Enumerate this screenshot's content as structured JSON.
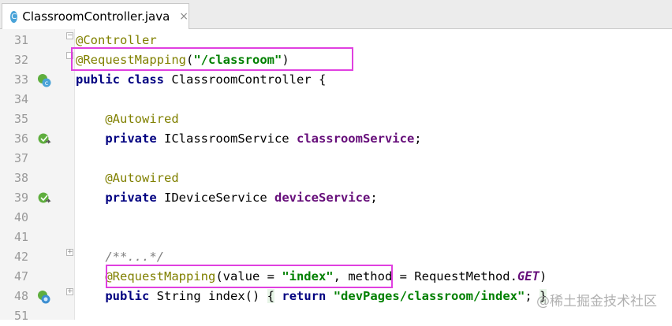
{
  "tab": {
    "icon": "class-icon",
    "icon_letter": "C",
    "filename": "ClassroomController.java",
    "close": "×"
  },
  "lines": [
    {
      "num": "31",
      "text": "@Controller"
    },
    {
      "num": "32",
      "text": "@RequestMapping(\"/classroom\")"
    },
    {
      "num": "33",
      "text": "public class ClassroomController {"
    },
    {
      "num": "34",
      "text": ""
    },
    {
      "num": "35",
      "text": "@Autowired"
    },
    {
      "num": "36",
      "text": "private IClassroomService classroomService;"
    },
    {
      "num": "37",
      "text": ""
    },
    {
      "num": "38",
      "text": "@Autowired"
    },
    {
      "num": "39",
      "text": "private IDeviceService deviceService;"
    },
    {
      "num": "40",
      "text": ""
    },
    {
      "num": "41",
      "text": ""
    },
    {
      "num": "42",
      "text": "/**...*/"
    },
    {
      "num": "47",
      "text": "@RequestMapping(value = \"index\", method = RequestMethod.GET)"
    },
    {
      "num": "48",
      "text": "public String index() { return \"devPages/classroom/index\"; }"
    },
    {
      "num": "51",
      "text": ""
    }
  ],
  "tokens": {
    "controller": "@Controller",
    "request_mapping": "@RequestMapping",
    "classroom_path": "\"/classroom\"",
    "public": "public",
    "class": "class",
    "class_name": "ClassroomController {",
    "autowired": "@Autowired",
    "private": "private",
    "iclassroom_type": "IClassroomService",
    "classroom_field": "classroomService",
    "idevice_type": "IDeviceService",
    "device_field": "deviceService",
    "javadoc": "/**...*/",
    "value_eq": "value = ",
    "index_str": "\"index\"",
    "method_eq": " method = RequestMethod.",
    "get_const": "GET",
    "string_type": "String",
    "index_method": "index() ",
    "return": "return",
    "dev_path": "\"devPages/classroom/index\"",
    "semi": ";",
    "open_brace": "{",
    "close_brace": "}"
  },
  "watermark": "@稀土掘金技术社区",
  "colors": {
    "annotation": "#808000",
    "keyword": "#000080",
    "string": "#008000",
    "field": "#660e7a",
    "highlight_box": "#e040e0"
  }
}
